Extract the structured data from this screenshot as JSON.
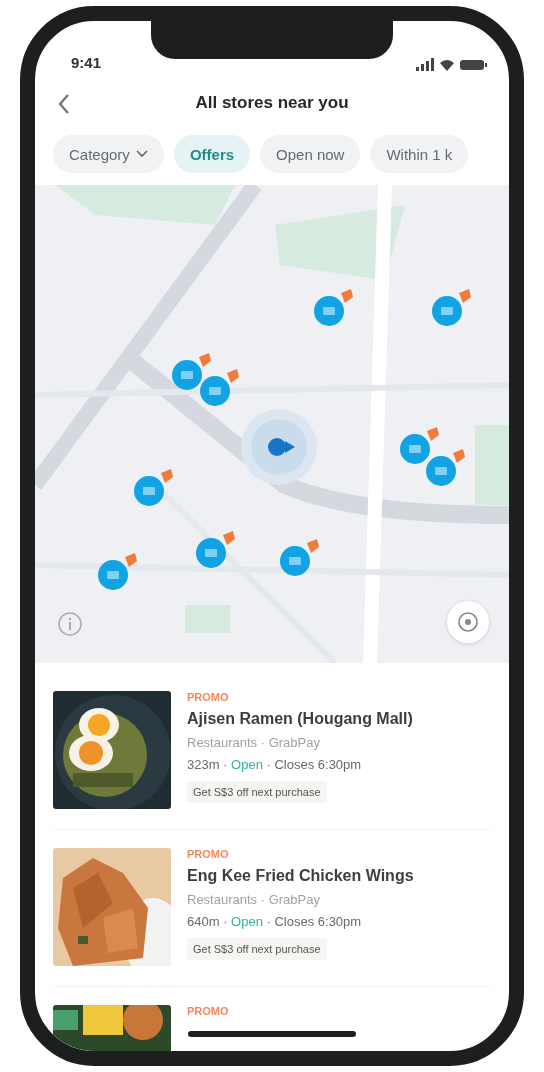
{
  "status_bar": {
    "time": "9:41"
  },
  "header": {
    "title": "All stores near you"
  },
  "filters": [
    {
      "label": "Category",
      "kind": "dropdown",
      "selected": false
    },
    {
      "label": "Offers",
      "kind": "chip",
      "selected": true
    },
    {
      "label": "Open now",
      "kind": "chip",
      "selected": false
    },
    {
      "label": "Within 1 k",
      "kind": "chip",
      "selected": false
    }
  ],
  "stores": [
    {
      "tag": "PROMO",
      "name": "Ajisen Ramen (Hougang Mall)",
      "category": "Restaurants · GrabPay",
      "meta": [
        {
          "text": "323m · ",
          "kind": "plain"
        },
        {
          "text": "Open",
          "kind": "open"
        },
        {
          "text": " · Closes 6:30pm",
          "kind": "plain"
        }
      ],
      "offer": "Get S$3 off next purchase"
    },
    {
      "tag": "PROMO",
      "name": "Eng Kee Fried Chicken Wings",
      "category": "Restaurants · GrabPay",
      "meta": [
        {
          "text": "640m · ",
          "kind": "plain"
        },
        {
          "text": "Open",
          "kind": "open"
        },
        {
          "text": " · Closes 6:30pm",
          "kind": "plain"
        }
      ],
      "offer": "Get S$3 off next purchase"
    },
    {
      "tag": "PROMO"
    }
  ]
}
